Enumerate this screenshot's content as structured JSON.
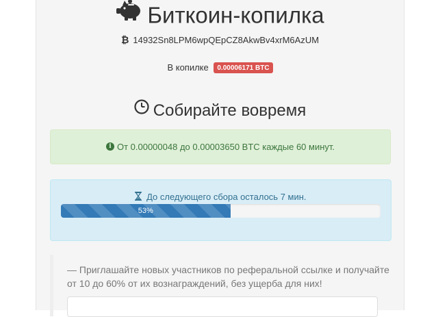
{
  "header": {
    "title": "Биткоин-копилка",
    "address": "14932Sn8LPM6wpQEpCZ8AkwBv4xrM6AzUM"
  },
  "balance": {
    "label": "В копилке",
    "amount": "0.00006171 BTC"
  },
  "collect": {
    "title": "Собирайте вовремя"
  },
  "reward_alert": {
    "text": "От 0.00000048 до 0.00003650 BTC каждые 60 минут."
  },
  "timer": {
    "text": "До следующего сбора осталось 7 мин.",
    "progress_label": "53%",
    "progress": 0.53
  },
  "referral": {
    "text": "— Приглашайте новых участников по реферальной ссылке и получайте от 10 до 60% от их вознаграждений, без ущерба для них!"
  },
  "colors": {
    "badge": "#d9534f",
    "success_bg": "#dff0d8",
    "info_bg": "#d9edf7",
    "progress_bar": "#337ab7"
  },
  "icons": {
    "title": "piggy-bank-icon",
    "address": "bitcoin-icon",
    "collect": "clock-icon",
    "reward": "info-circle-icon",
    "timer": "hourglass-icon"
  }
}
